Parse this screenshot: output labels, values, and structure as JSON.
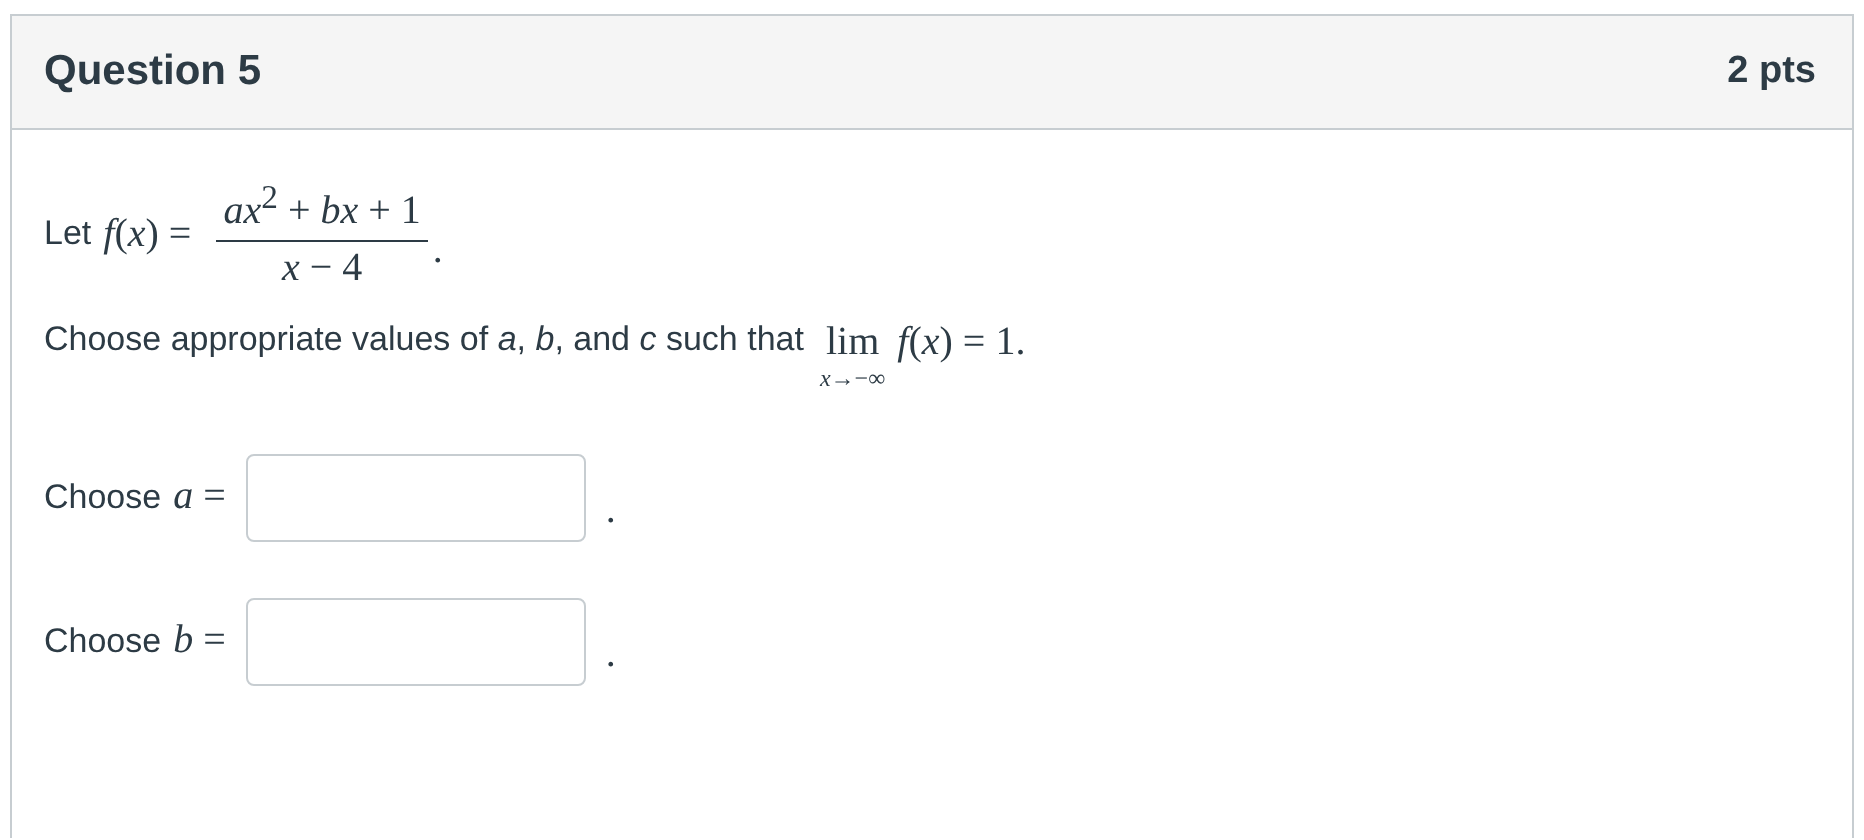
{
  "question": {
    "title": "Question 5",
    "points": "2 pts",
    "definition": {
      "lead": "Let",
      "lhs": "*f*(*x*) =",
      "numerator": "*ax*$^{2}$ + *bx* + 1",
      "denominator": "*x* − 4",
      "end": "."
    },
    "instruction": {
      "text": "Choose appropriate values of *a*, *b*, and *c* such that",
      "limit": "lim",
      "limit_sub": "*x*→−∞",
      "expression": "*f*(*x*) = 1."
    },
    "answers": [
      {
        "label": "Choose",
        "variable": "*a* =",
        "end": "."
      },
      {
        "label": "Choose",
        "variable": "*b* =",
        "end": "."
      }
    ]
  }
}
